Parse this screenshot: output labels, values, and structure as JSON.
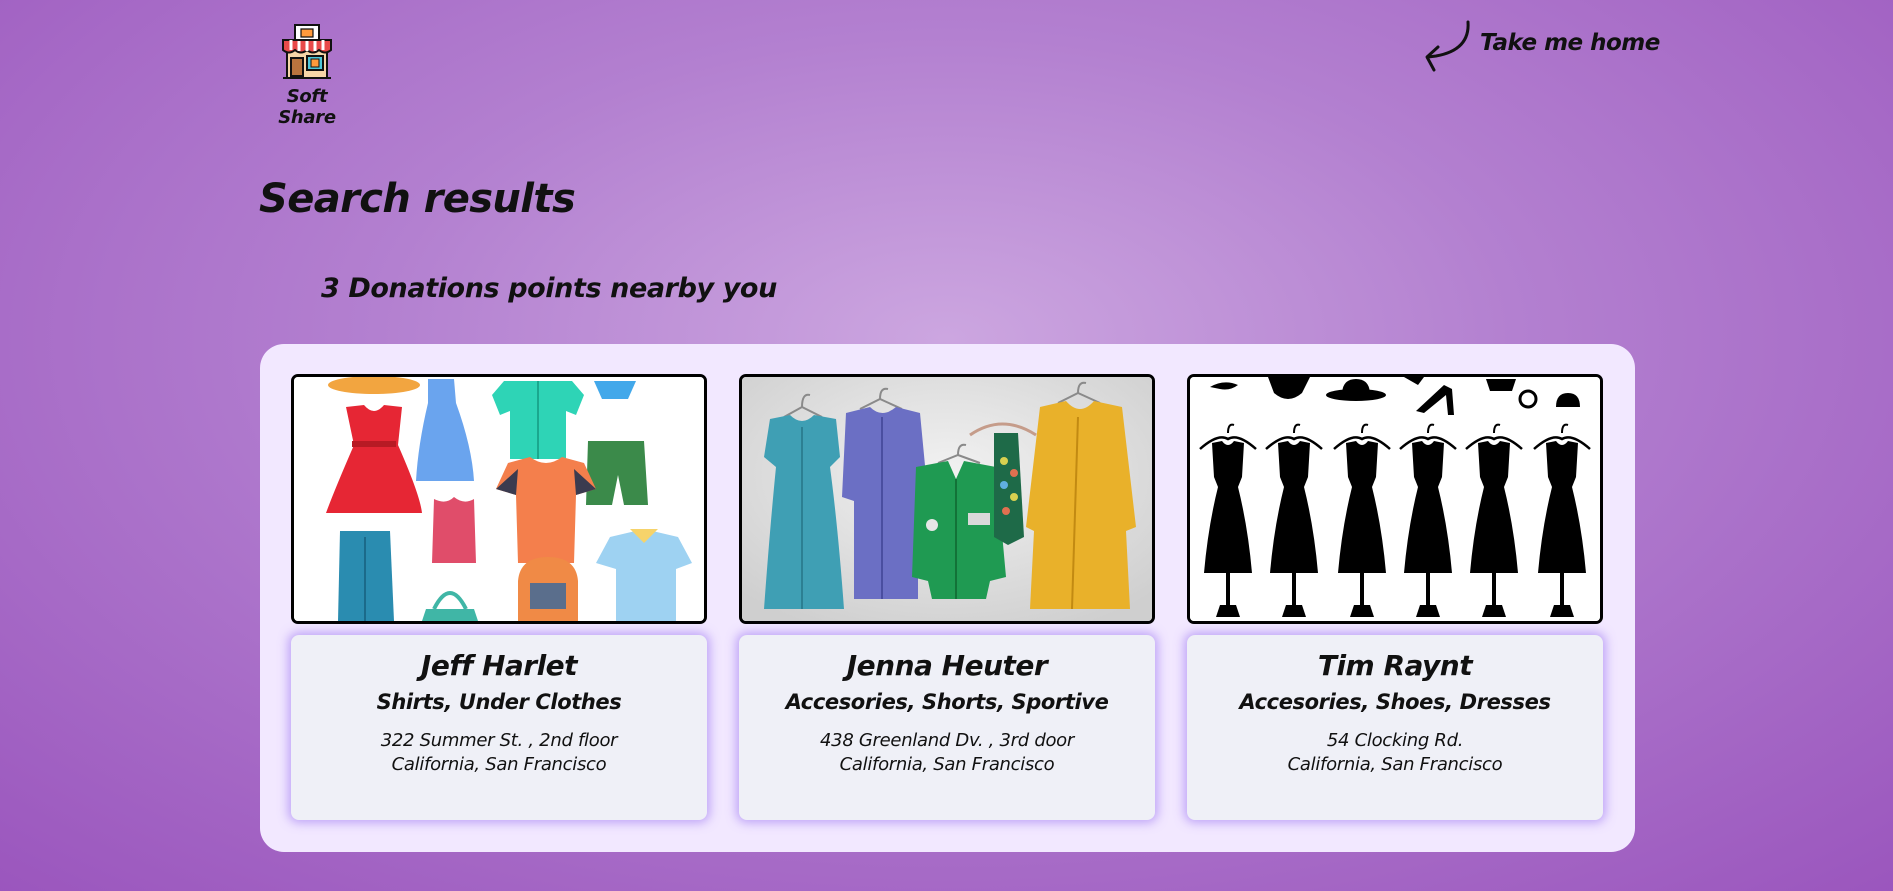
{
  "logo": {
    "text": "Soft Share",
    "icon": "shop-icon"
  },
  "nav": {
    "home_label": "Take me home",
    "icon": "curved-arrow-icon"
  },
  "page": {
    "title": "Search results",
    "subtitle": "3 Donations points nearby you"
  },
  "results": [
    {
      "name": "Jeff Harlet",
      "categories": "Shirts, Under Clothes",
      "address": "322 Summer St. , 2nd floor",
      "city": "California, San Francisco",
      "image": "colorful-clothes-illustration"
    },
    {
      "name": "Jenna Heuter",
      "categories": "Accesories, Shorts, Sportive",
      "address": "438 Greenland Dv. , 3rd door",
      "city": "California, San Francisco",
      "image": "clothes-on-hangers-photo"
    },
    {
      "name": "Tim Raynt",
      "categories": "Accesories, Shoes, Dresses",
      "address": "54 Clocking Rd.",
      "city": "California, San Francisco",
      "image": "black-dress-silhouettes"
    }
  ],
  "colors": {
    "background": "#a55fc4",
    "panel": "#f2e8ff",
    "card": "#eff0f7",
    "glow": "#966ef0"
  }
}
